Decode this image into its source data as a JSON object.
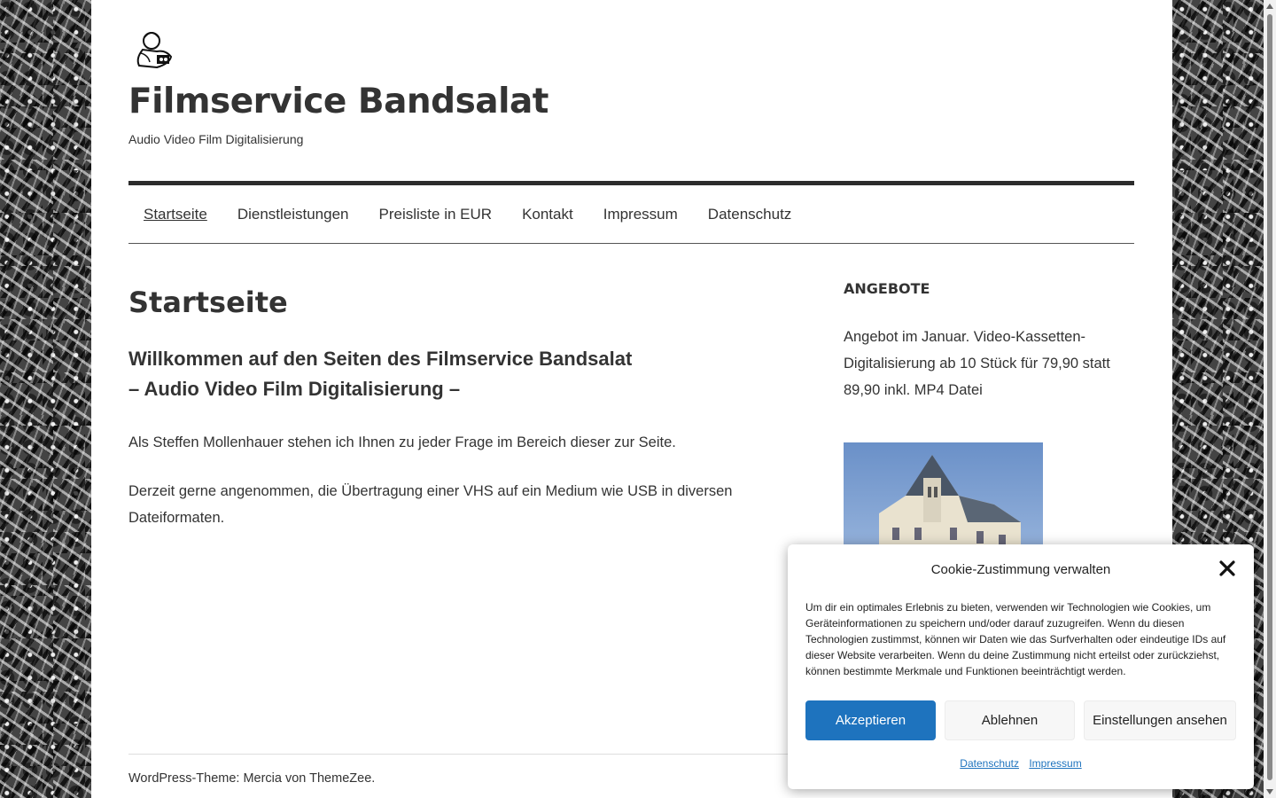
{
  "site": {
    "title": "Filmservice Bandsalat",
    "tagline": "Audio Video Film Digitalisierung"
  },
  "nav": {
    "items": [
      {
        "label": "Startseite",
        "active": true
      },
      {
        "label": "Dienstleistungen"
      },
      {
        "label": "Preisliste in EUR"
      },
      {
        "label": "Kontakt"
      },
      {
        "label": "Impressum"
      },
      {
        "label": "Datenschutz"
      }
    ]
  },
  "main": {
    "page_title": "Startseite",
    "welcome_line1": "Willkommen auf den Seiten des Filmservice Bandsalat",
    "welcome_line2": "– Audio Video Film Digitalisierung –",
    "para1": "Als Steffen Mollenhauer stehen ich Ihnen zu jeder Frage im Bereich dieser zur Seite.",
    "para2": "Derzeit gerne angenommen, die Übertragung einer VHS auf ein Medium wie USB in diversen Dateiformaten."
  },
  "sidebar": {
    "widget_title": "Angebote",
    "widget_text": "Angebot im Januar. Video-Kassetten-Digitalisierung ab 10 Stück für 79,90 statt 89,90 inkl. MP4 Datei"
  },
  "footer": {
    "text": "WordPress-Theme: Mercia von ThemeZee."
  },
  "cookie": {
    "title": "Cookie-Zustimmung verwalten",
    "body": "Um dir ein optimales Erlebnis zu bieten, verwenden wir Technologien wie Cookies, um Geräteinformationen zu speichern und/oder darauf zuzugreifen. Wenn du diesen Technologien zustimmst, können wir Daten wie das Surfverhalten oder eindeutige IDs auf dieser Website verarbeiten. Wenn du deine Zustimmung nicht erteilst oder zurückziehst, können bestimmte Merkmale und Funktionen beeinträchtigt werden.",
    "accept_label": "Akzeptieren",
    "deny_label": "Ablehnen",
    "settings_label": "Einstellungen ansehen",
    "link_privacy": "Datenschutz",
    "link_imprint": "Impressum",
    "accent_color": "#1e73be"
  }
}
